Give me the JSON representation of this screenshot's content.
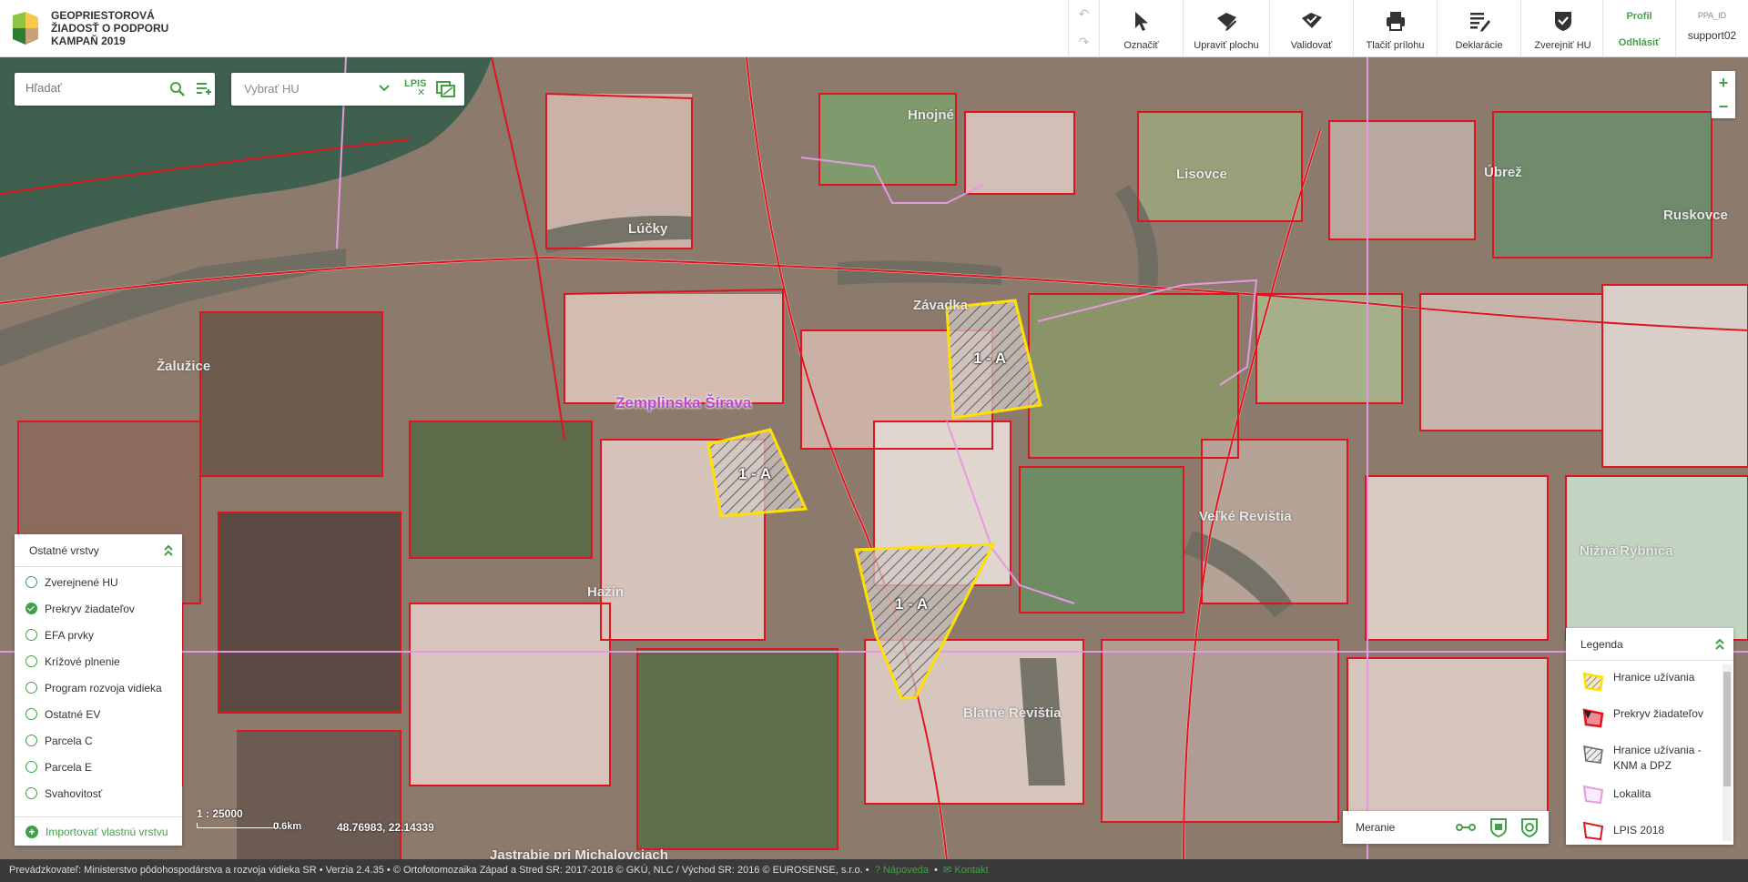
{
  "app": {
    "title_line1": "GEOPRIESTOROVÁ",
    "title_line2": "ŽIADOSŤ O PODPORU",
    "title_line3": "KAMPAŇ 2019"
  },
  "toolbar": {
    "items": [
      {
        "label": "Označiť",
        "icon": "cursor-icon"
      },
      {
        "label": "Upraviť plochu",
        "icon": "edit-area-icon"
      },
      {
        "label": "Validovať",
        "icon": "validate-icon"
      },
      {
        "label": "Tlačiť prílohu",
        "icon": "printer-icon"
      },
      {
        "label": "Deklarácie",
        "icon": "declarations-icon"
      },
      {
        "label": "Zverejniť HU",
        "icon": "publish-shield-icon"
      }
    ],
    "profile_label": "Profil",
    "logout_label": "Odhlásiť",
    "user_id_label": "PPA_ID",
    "username": "support02"
  },
  "search": {
    "placeholder": "Hľadať"
  },
  "hu_select": {
    "placeholder": "Vybrať HU",
    "lpis_label": "LPIS"
  },
  "map_labels": {
    "hnojne": "Hnojné",
    "lucky": "Lúčky",
    "lisovce": "Lisovce",
    "ubrez": "Úbrež",
    "ruskovce": "Ruskovce",
    "zavadka": "Závadka",
    "zaluzice": "Žalužice",
    "zemplinska": "Zemplinska Šírava",
    "hazin": "Hažín",
    "velke_revistia": "Veľké Revištia",
    "nizna_rybnica": "Nižná Rybnica",
    "blatne_revistia": "Blatné Revištia",
    "jastrabie": "Jastrabie pri Michalovciach",
    "parcel_1": "1 - A",
    "parcel_2": "1 - A",
    "parcel_3": "1 - A"
  },
  "layers_panel": {
    "title": "Ostatné vrstvy",
    "items": [
      {
        "label": "Zverejnené HU",
        "checked": false
      },
      {
        "label": "Prekryv žiadateľov",
        "checked": true
      },
      {
        "label": "EFA prvky",
        "checked": false
      },
      {
        "label": "Krížové plnenie",
        "checked": false
      },
      {
        "label": "Program rozvoja vidieka",
        "checked": false
      },
      {
        "label": "Ostatné EV",
        "checked": false
      },
      {
        "label": "Parcela C",
        "checked": false
      },
      {
        "label": "Parcela E",
        "checked": false
      },
      {
        "label": "Svahovitosť",
        "checked": false
      }
    ],
    "import_label": "Importovať vlastnú vrstvu"
  },
  "scale": {
    "ratio": "1 : 25000",
    "bar_label": "0.6km"
  },
  "coordinates": "48.76983, 22.14339",
  "measure": {
    "label": "Meranie"
  },
  "legend": {
    "title": "Legenda",
    "items": [
      {
        "label": "Hranice užívania"
      },
      {
        "label": "Prekryv žiadateľov"
      },
      {
        "label": "Hranice užívania - KNM a DPZ"
      },
      {
        "label": "Lokalita"
      },
      {
        "label": "LPIS 2018"
      }
    ]
  },
  "footer": {
    "text": "Prevádzkovateľ: Ministerstvo pôdohospodárstva a rozvoja vidieka SR • Verzia 2.4.35 • © Ortofotomozaika Západ a Stred SR: 2017-2018 © GKÚ, NLC / Východ SR: 2016 © EUROSENSE, s.r.o. •",
    "help_label": "Nápoveda",
    "contact_label": "Kontakt"
  },
  "colors": {
    "accent": "#43a047",
    "parcel_border": "#e0141e",
    "hu_border": "#ffe100",
    "locality": "#e59ae0"
  }
}
